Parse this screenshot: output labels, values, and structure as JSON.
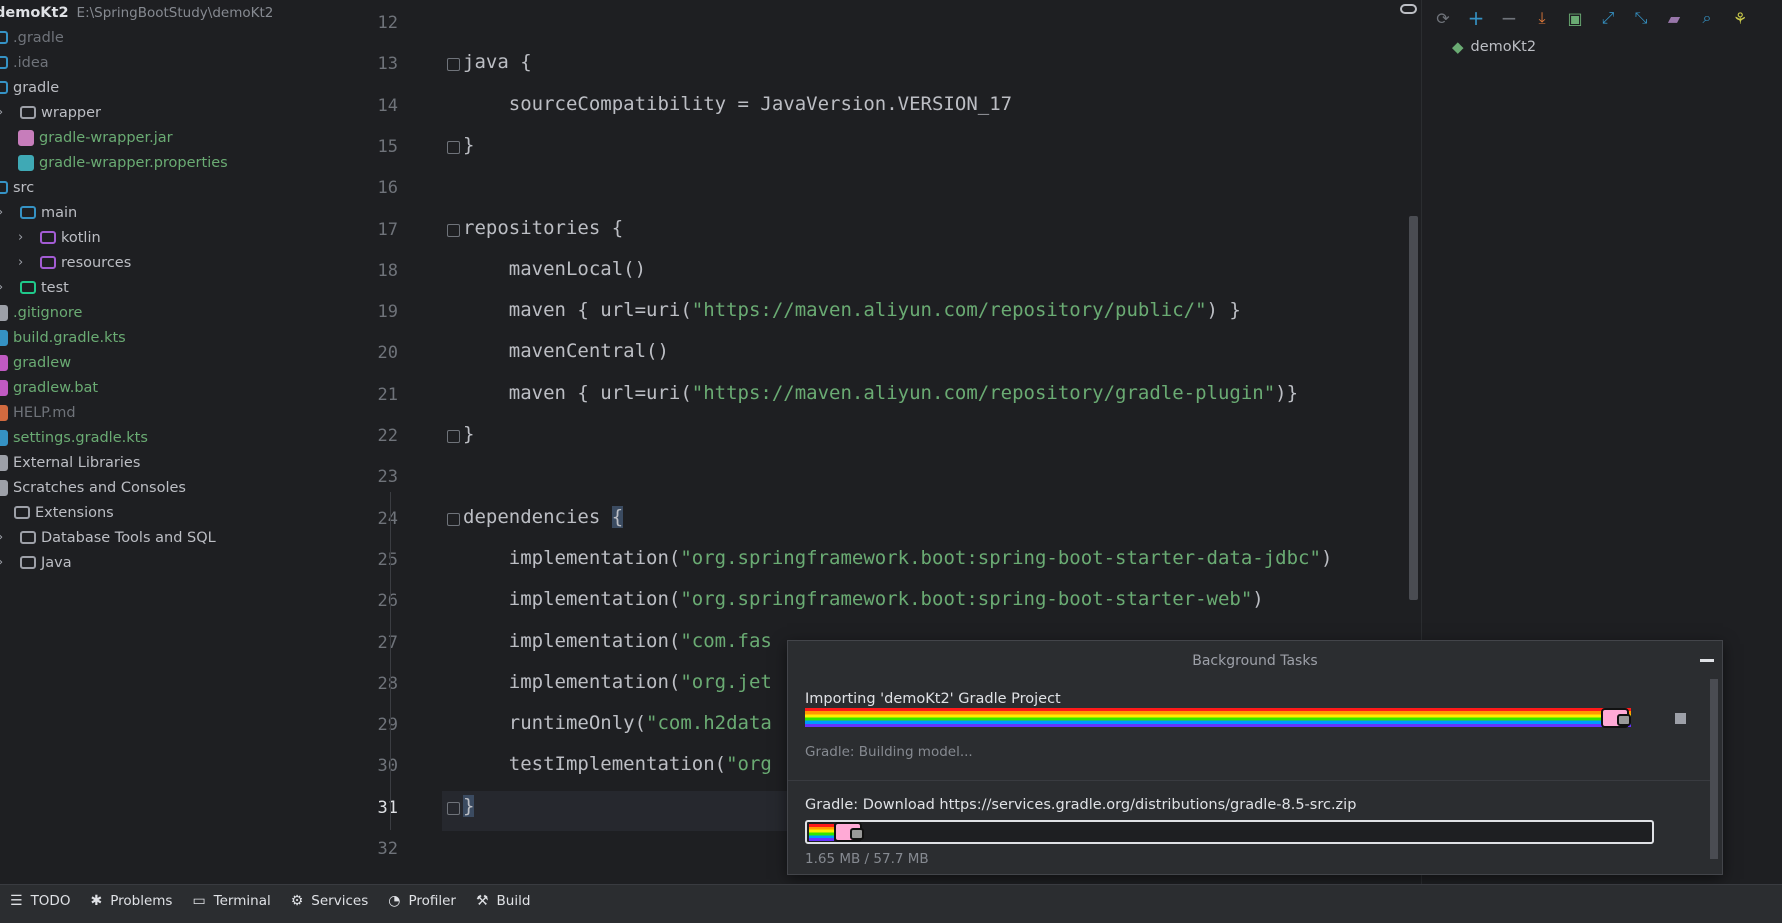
{
  "project": {
    "name": "demoKt2",
    "path": "E:\\SpringBootStudy\\demoKt2",
    "items": [
      {
        "label": ".gradle",
        "indent": 0,
        "color": "grey",
        "icon": "folder-gradle-icon",
        "chev": false
      },
      {
        "label": ".idea",
        "indent": 0,
        "color": "grey",
        "icon": "folder-idea-icon",
        "chev": false
      },
      {
        "label": "gradle",
        "indent": 0,
        "color": "normal",
        "icon": "folder-gradle-icon",
        "chev": false
      },
      {
        "label": "wrapper",
        "indent": 1,
        "color": "normal",
        "icon": "folder-icon",
        "chev": true
      },
      {
        "label": "gradle-wrapper.jar",
        "indent": 2,
        "color": "green",
        "icon": "jar-icon",
        "chev": false
      },
      {
        "label": "gradle-wrapper.properties",
        "indent": 2,
        "color": "green",
        "icon": "properties-icon",
        "chev": false
      },
      {
        "label": "src",
        "indent": 0,
        "color": "normal",
        "icon": "folder-src-icon",
        "chev": false
      },
      {
        "label": "main",
        "indent": 1,
        "color": "normal",
        "icon": "folder-source-icon",
        "chev": true
      },
      {
        "label": "kotlin",
        "indent": 2,
        "color": "normal",
        "icon": "folder-kotlin-icon",
        "chev": true
      },
      {
        "label": "resources",
        "indent": 2,
        "color": "normal",
        "icon": "folder-resources-icon",
        "chev": true
      },
      {
        "label": "test",
        "indent": 1,
        "color": "normal",
        "icon": "folder-test-icon",
        "chev": true
      },
      {
        "label": ".gitignore",
        "indent": 0,
        "color": "green",
        "icon": "gitignore-icon",
        "chev": false
      },
      {
        "label": "build.gradle.kts",
        "indent": 0,
        "color": "green",
        "icon": "gradle-file-icon",
        "chev": false
      },
      {
        "label": "gradlew",
        "indent": 0,
        "color": "green",
        "icon": "gradlew-icon",
        "chev": false
      },
      {
        "label": "gradlew.bat",
        "indent": 0,
        "color": "green",
        "icon": "gradlew-icon",
        "chev": false
      },
      {
        "label": "HELP.md",
        "indent": 0,
        "color": "grey",
        "icon": "markdown-icon",
        "chev": false
      },
      {
        "label": "settings.gradle.kts",
        "indent": 0,
        "color": "green",
        "icon": "gradle-file-icon",
        "chev": false
      },
      {
        "label": "External Libraries",
        "indent": 0,
        "color": "normal",
        "icon": "library-icon",
        "chev": false
      },
      {
        "label": "Scratches and Consoles",
        "indent": 0,
        "color": "normal",
        "icon": "scratch-icon",
        "chev": false
      },
      {
        "label": "Extensions",
        "indent": 0,
        "color": "normal",
        "icon": "folder-icon",
        "chev": true
      },
      {
        "label": "Database Tools and SQL",
        "indent": 1,
        "color": "normal",
        "icon": "folder-icon",
        "chev": true
      },
      {
        "label": "Java",
        "indent": 1,
        "color": "normal",
        "icon": "folder-icon",
        "chev": true
      }
    ]
  },
  "editor": {
    "lines": [
      {
        "num": "12",
        "segs": []
      },
      {
        "num": "13",
        "fold": true,
        "segs": [
          {
            "t": "java {",
            "c": "n"
          }
        ]
      },
      {
        "num": "14",
        "segs": [
          {
            "t": "    sourceCompatibility = JavaVersion.VERSION_17",
            "c": "n"
          }
        ]
      },
      {
        "num": "15",
        "fold": true,
        "segs": [
          {
            "t": "}",
            "c": "n"
          }
        ]
      },
      {
        "num": "16",
        "segs": []
      },
      {
        "num": "17",
        "fold": true,
        "segs": [
          {
            "t": "repositories {",
            "c": "n"
          }
        ]
      },
      {
        "num": "18",
        "segs": [
          {
            "t": "    mavenLocal()",
            "c": "n"
          }
        ]
      },
      {
        "num": "19",
        "segs": [
          {
            "t": "    maven { url=uri(",
            "c": "n"
          },
          {
            "t": "\"https://maven.aliyun.com/repository/public/\"",
            "c": "s"
          },
          {
            "t": ") }",
            "c": "n"
          }
        ]
      },
      {
        "num": "20",
        "segs": [
          {
            "t": "    mavenCentral()",
            "c": "n"
          }
        ]
      },
      {
        "num": "21",
        "segs": [
          {
            "t": "    maven { url=uri(",
            "c": "n"
          },
          {
            "t": "\"https://maven.aliyun.com/repository/gradle-plugin\"",
            "c": "s"
          },
          {
            "t": ")}",
            "c": "n"
          }
        ]
      },
      {
        "num": "22",
        "fold": true,
        "segs": [
          {
            "t": "}",
            "c": "n"
          }
        ]
      },
      {
        "num": "23",
        "segs": []
      },
      {
        "num": "24",
        "fold": true,
        "segs": [
          {
            "t": "dependencies ",
            "c": "n"
          },
          {
            "t": "{",
            "c": "b"
          }
        ]
      },
      {
        "num": "25",
        "segs": [
          {
            "t": "    implementation(",
            "c": "n"
          },
          {
            "t": "\"org.springframework.boot:spring-boot-starter-data-jdbc\"",
            "c": "s"
          },
          {
            "t": ")",
            "c": "n"
          }
        ]
      },
      {
        "num": "26",
        "segs": [
          {
            "t": "    implementation(",
            "c": "n"
          },
          {
            "t": "\"org.springframework.boot:spring-boot-starter-web\"",
            "c": "s"
          },
          {
            "t": ")",
            "c": "n"
          }
        ]
      },
      {
        "num": "27",
        "segs": [
          {
            "t": "    implementation(",
            "c": "n"
          },
          {
            "t": "\"com.fas",
            "c": "s"
          }
        ]
      },
      {
        "num": "28",
        "segs": [
          {
            "t": "    implementation(",
            "c": "n"
          },
          {
            "t": "\"org.jet",
            "c": "s"
          }
        ]
      },
      {
        "num": "29",
        "segs": [
          {
            "t": "    runtimeOnly(",
            "c": "n"
          },
          {
            "t": "\"com.h2data",
            "c": "s"
          }
        ]
      },
      {
        "num": "30",
        "segs": [
          {
            "t": "    testImplementation(",
            "c": "n"
          },
          {
            "t": "\"org",
            "c": "s"
          }
        ]
      },
      {
        "num": "31",
        "fold": true,
        "segs": [
          {
            "t": "}",
            "c": "b"
          }
        ]
      },
      {
        "num": "32",
        "segs": []
      }
    ]
  },
  "gradle": {
    "project": "demoKt2"
  },
  "bottom": {
    "tabs": [
      {
        "label": "TODO",
        "icon": "todo-icon",
        "glyph": "☰"
      },
      {
        "label": "Problems",
        "icon": "problems-icon",
        "glyph": "✱"
      },
      {
        "label": "Terminal",
        "icon": "terminal-icon",
        "glyph": "▭"
      },
      {
        "label": "Services",
        "icon": "services-icon",
        "glyph": "⚙"
      },
      {
        "label": "Profiler",
        "icon": "profiler-icon",
        "glyph": "◔"
      },
      {
        "label": "Build",
        "icon": "build-icon",
        "glyph": "⚒"
      }
    ]
  },
  "bg_tasks": {
    "title": "Background Tasks",
    "task1": {
      "title": "Importing 'demoKt2' Gradle Project",
      "status": "Gradle: Building model...",
      "progress": 1.0
    },
    "task2": {
      "title": "Gradle: Download https://services.gradle.org/distributions/gradle-8.5-src.zip",
      "status": "1.65 MB / 57.7 MB",
      "progress": 0.03
    }
  },
  "colors": {
    "accent_green": "#6aab73",
    "vcs_grey": "#6f737a",
    "string": "#6aab73"
  }
}
